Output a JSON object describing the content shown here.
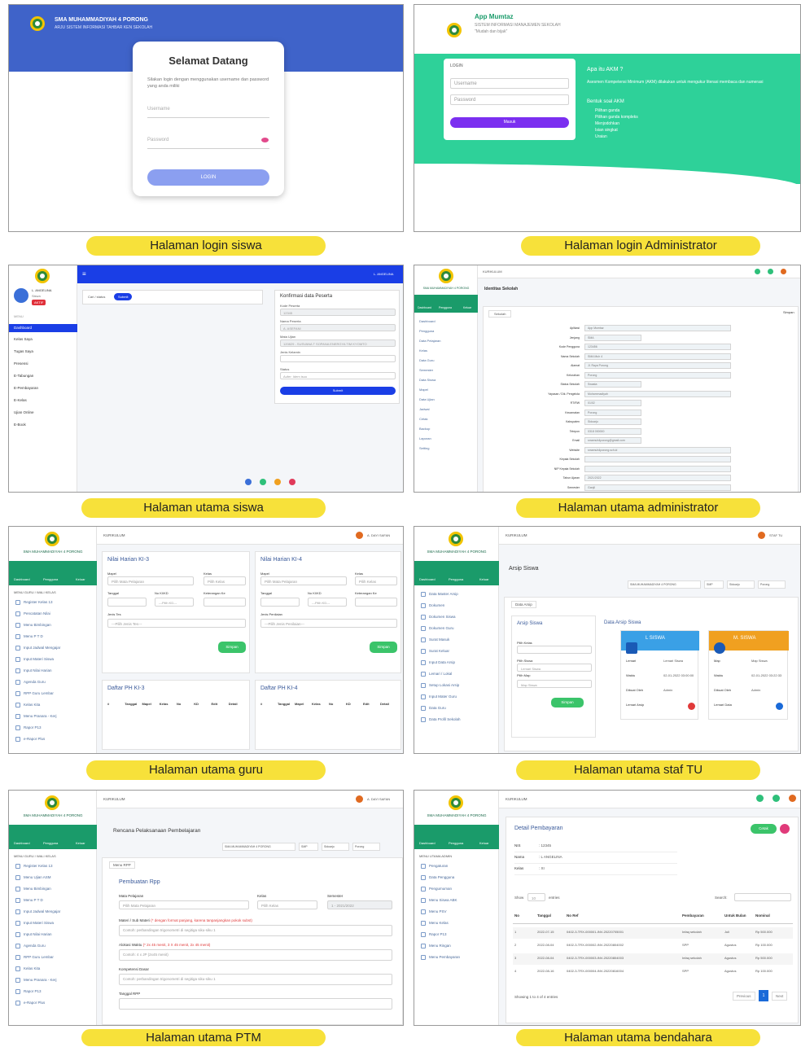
{
  "captions": {
    "p1": "Halaman login siswa",
    "p2": "Halaman login Administrator",
    "p3": "Halaman utama siswa",
    "p4": "Halaman utama administrator",
    "p5": "Halaman utama guru",
    "p6": "Halaman utama staf TU",
    "p7": "Halaman utama PTM",
    "p8": "Halaman utama bendahara"
  },
  "school": {
    "name": "SMA MUHAMMADIYAH 4 PORONG",
    "subtitle": "ARJU SISTEM INFORMASI TAHBAR KEN SEKOLAH",
    "brand_short": "SMA MUHAMMADIYAH 4 PORONG"
  },
  "login_siswa": {
    "title": "Selamat Datang",
    "subtitle": "Silakan login dengan menggunakan username dan password yang anda miliki",
    "username_placeholder": "Username",
    "password_placeholder": "Password",
    "button": "LOGIN"
  },
  "login_admin": {
    "app_title": "App Mumtaz",
    "app_sub": "SISTEM INFORMASI MANAJEMEN SEKOLAH",
    "app_quote": "\"Mudah dan bijak\"",
    "form_label": "LOGIN",
    "username_placeholder": "Username",
    "password_placeholder": "Password",
    "button": "Masuk",
    "info_title": "Apa itu AKM ?",
    "info_text": "Asesmen Kompetensi Minimum (AKM) dilakukan untuk mengukur literasi membaca dan numerasi",
    "info_list_title": "Bentuk soal AKM",
    "info_list": [
      "Pilihan ganda",
      "Pilihan ganda kompleks",
      "Menjodohkan",
      "Isian singkat",
      "Uraian"
    ]
  },
  "siswa_home": {
    "search_label": "Cari / status",
    "search_badge": "Submit",
    "form_title": "Konfirmasi data Peserta",
    "labels": [
      "Kode Peserta",
      "Nama Peserta",
      "Mata Ujian",
      "Jenis Kelamin",
      "Status"
    ],
    "values": [
      "12345",
      "A. ASEFANI",
      "120829 - SUSVANA T SOPANA ENERGYA TIM KYOMTO",
      "",
      "Aufer: Idem isuo"
    ],
    "submit": "Submit",
    "sidebar_user": "L. ANGELINA",
    "sidebar_role": "Siswa",
    "sidebar_badge": "AKTIF",
    "sidebar_head": "MENU",
    "sidebar_items": [
      "Dashboard",
      "Kelas Saya",
      "Tugas Saya",
      "Presensi",
      "E-Tabungan",
      "E-Pembayaran",
      "E-Kelas",
      "Ujian Online",
      "E-Book"
    ],
    "top_user": "L. ANGELINA"
  },
  "admin_home": {
    "top_title": "KURIKULUM",
    "panel_title": "Identitas Sekolah",
    "tab": "Sekolah",
    "right_btn": "Simpan",
    "rows": [
      "Aplikasi",
      "Jenjang",
      "Kode Pengguna",
      "Nama Sekolah",
      "Alamat",
      "Kelurahan",
      "Status Sekolah",
      "Yayasan / Dik. Pengelola",
      "RT/RW",
      "Kecamatan",
      "Kabupaten",
      "Telepon",
      "Email",
      "Website",
      "Kepala Sekolah",
      "NIP Kepala Sekolah",
      "Tahun Ajaran",
      "Semester"
    ],
    "values": [
      "App Mumtaz",
      "SMA",
      "123456",
      "SMA Muh 4",
      "Jl. Raya Porong",
      "Porong",
      "Swasta",
      "Muhammadiyah",
      "01/02",
      "Porong",
      "Sidoarjo",
      "0318 000000",
      "smamuh4porong@gmail.com",
      "smamuh4porong.sch.id",
      "",
      "",
      "2021/2022",
      "Ganjil"
    ],
    "sidebar_items": [
      "Dashboard",
      "Pengguna",
      "Data Pelajaran",
      "Kelas",
      "Data Guru",
      "Semester",
      "Data Siswa",
      "Mapel",
      "Data Ujian",
      "Jadwal",
      "Cetak",
      "Backup",
      "Laporan",
      "Setting"
    ],
    "dash_labels": [
      "Dashboard",
      "Pengguna",
      "Keluar"
    ]
  },
  "guru_home": {
    "top_title": "KURIKULUM",
    "user": "A. DAYI SAFAN",
    "school": "SMA MUHAMMADIYAH 4 PORONG",
    "dash": [
      "Dashboard",
      "Pengguna",
      "Keluar"
    ],
    "menu_head": "MENU GURU / WALI KELAS",
    "menu": [
      "Register Kelas 13",
      "Pencatatan Nilai",
      "Menu Bimbingan",
      "Menu P T D",
      "Input Jadwal Mengajar",
      "Input Materi Siswa",
      "Input Nilai Harian",
      "Agenda Guru",
      "RPP Guru Lembar",
      "Kelas Kita",
      "Menu Pranara - Kerj",
      "Rapor P13",
      "e-Rapor Plus"
    ],
    "card1_title": "Nilai Harian KI-3",
    "card2_title": "Nilai Harian KI-4",
    "mapel_label": "Mapel",
    "kelas_label": "Kelas",
    "mapel_placeholder": "Pilih Mata Pelajaran",
    "kelas_placeholder": "Pilih Kelas",
    "tanggal_label": "Tanggal",
    "kd_label": "No KI/KD",
    "keterangan_label": "Keterangan Ke",
    "jenis_label1": "Jenis Tes",
    "jenis_label2": "Jenis Penilaian",
    "jenis_ph1": "---Pilih Jenis Tes---",
    "jenis_ph2": "---Pilih Jenis Penilaian---",
    "kd_ph1": "---Pilih KD---",
    "kd_ph2": "---Pilih KD---",
    "simpan": "Simpan",
    "daftar1": "Daftar PH KI-3",
    "daftar2": "Daftar PH KI-4",
    "cols": [
      "#",
      "Tanggal",
      "Mapel",
      "Kelas",
      "No",
      "KD",
      "Edit",
      "Detail"
    ]
  },
  "tu_home": {
    "top_title": "KURIKULUM",
    "user": "STAF TU",
    "panel_title": "Arsip Siswa",
    "tab": "Data Arsip",
    "filters": [
      "SMA MUHAMMADIYAH 4 PORONG",
      "SMP",
      "Sidoarjo",
      "Porong"
    ],
    "left_title": "Arsip Siswa",
    "right_title": "Data Arsip Siswa",
    "pilih_kelas": "Pilih Kelas",
    "pilih_siswa": "Pilih Siswa",
    "pilih_map": "Pilih Map",
    "lemari": "Lemari Siswa",
    "map": "Map Siswa",
    "simpan": "Simpan",
    "card1_name": "L SISWA",
    "card2_name": "M. SISWA",
    "card1_rows": [
      [
        "Lemari",
        "Lemari Siswa"
      ],
      [
        "Waktu",
        "02-01-2022 03:00:00"
      ],
      [
        "Dibuat Oleh",
        "Admin"
      ],
      [
        "Lemari Arsip",
        ""
      ]
    ],
    "card2_rows": [
      [
        "Map",
        "Map Siswa"
      ],
      [
        "Waktu",
        "02-01-2022 03:22:33"
      ],
      [
        "Dibuat Oleh",
        "Admin"
      ],
      [
        "Lemari Data",
        ""
      ]
    ],
    "menu": [
      "Data Master Arsip",
      "Dokumen",
      "Dokumen Siswa",
      "Dokumen Guru",
      "Surat Masuk",
      "Surat Keluar",
      "Input Data Arsip",
      "Lemari / Lokal",
      "Setup Lokasi Arsip",
      "Input Mater Guru",
      "Data Guru",
      "Data Profil Sekolah"
    ]
  },
  "ptm_home": {
    "top_title": "KURIKULUM",
    "panel_title": "Rencana Pelaksanaan Pembelajaran",
    "tab": "Menu RPP",
    "filters": [
      "SMA MUHAMMADIYAH 4 PORONG",
      "SMP",
      "Sidoarjo",
      "Porong"
    ],
    "form_title": "Pembuatan Rpp",
    "labels": [
      "Mata Pelajaran",
      "Kelas",
      "Semester"
    ],
    "mapel_ph": "Pilih Mata Pelajaran",
    "kelas_ph": "Pilih Kelas",
    "semester_val": "1 - 2021/2022",
    "materi_label": "Materi / Sub Materi",
    "materi_note": "(* dengan format panjang, karena tanpanjangkan pokok subst)",
    "materi_ph": "Contoh: perbandingan trigonometri di segitiga siku-siku 1",
    "alokasi_label": "Alokasi Waktu",
    "alokasi_note": "(* 2x 45 menit, 3 X 45 menit, 2x 45 menit)",
    "alokasi_ph": "Contoh: 4 x JP (2x45 menit)",
    "kompetensi_label": "Kompetensi Dasar",
    "kompetensi_ph": "Contoh: perbandingan trigonometri di segitiga siku-siku 1",
    "tanggal_label": "Tanggal RPP",
    "menu": [
      "Register Kelas 13",
      "Menu Ujian ASM",
      "Menu Bimbingan",
      "Menu P T D",
      "Input Jadwal Mengajar",
      "Input Materi Siswa",
      "Input Nilai Harian",
      "Agenda Guru",
      "RPP Guru Lembar",
      "Kelas Kita",
      "Menu Pranara - Kerj",
      "Rapor P13",
      "e-Rapor Plus"
    ]
  },
  "bendahara_home": {
    "top_title": "KURIKULUM",
    "panel_title": "Detail Pembayaran",
    "btn_cetak": "Cetak",
    "info": [
      [
        "NIS",
        ": 12345"
      ],
      [
        "Nama",
        ": L ANGELINA"
      ],
      [
        "Kelas",
        ": XI"
      ]
    ],
    "show_label": "Show",
    "show_val": "10",
    "entries": "entries",
    "search_label": "Search:",
    "cols": [
      "No",
      "Tanggal",
      "No Ref",
      "Pembayaran",
      "Untuk Bulan",
      "Nominal"
    ],
    "rows": [
      [
        "1",
        "2022-07-15",
        "0402-3-TRX-000001-INV-20220705001",
        "Infaq sekolah",
        "Juli",
        "Rp 500.000"
      ],
      [
        "2",
        "2022-08-04",
        "0402-3-TRX-000002-INV-20220804002",
        "SPP",
        "Agustus",
        "Rp 100.000"
      ],
      [
        "3",
        "2022-08-04",
        "0402-3-TRX-000003-INV-20220804003",
        "Infaq sekolah",
        "Agustus",
        "Rp 500.000"
      ],
      [
        "4",
        "2022-08-16",
        "0402-3-TRX-000004-INV-20220816004",
        "SPP",
        "Agustus",
        "Rp 100.000"
      ]
    ],
    "showing": "Showing 1 to 4 of 4 entries",
    "prev": "Previous",
    "page": "1",
    "next": "Next",
    "menu_head": "MENU UTAMA ADMIN",
    "menu": [
      "Pengaturan",
      "Data Pengguna",
      "Pengumuman",
      "Menu Siswa ABK",
      "Menu PSV",
      "Menu Kelas",
      "Rapor P13",
      "Menu Ringan",
      "Menu Pembayaran"
    ]
  },
  "colors": {
    "caption_bg": "#f7e13a",
    "login_blue": "#3f63c9",
    "login_btn": "#8b9ff0",
    "admin_green": "#2ed199",
    "admin_btn": "#7b2ff0",
    "submit_blue": "#1a3ee6",
    "sidebar_green": "#19a06a",
    "simpan_green": "#3bc46a",
    "card_blue": "#3aa0e6",
    "card_orange": "#f0a020"
  }
}
